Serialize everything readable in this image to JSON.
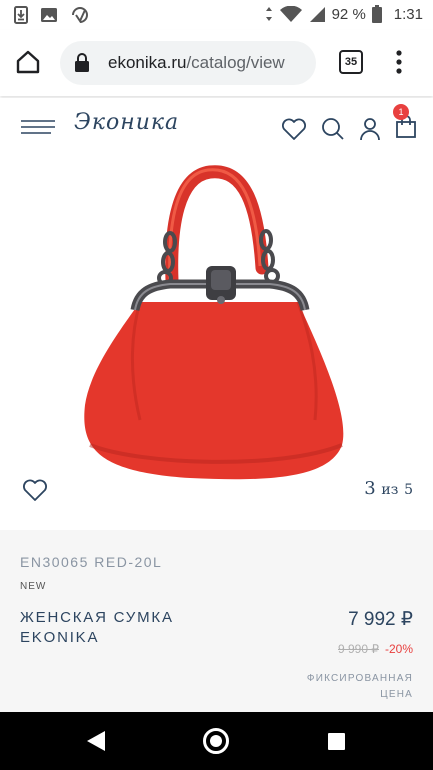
{
  "status_bar": {
    "battery": "92 %",
    "time": "1:31",
    "icons": [
      "download-notification-icon",
      "image-notification-icon",
      "data-saver-icon",
      "wifi-icon",
      "signal-icon",
      "battery-icon"
    ]
  },
  "browser": {
    "url_domain": "ekonika.ru",
    "url_path": "/catalog/view",
    "tab_count": "35",
    "icons": [
      "home-icon",
      "lock-icon",
      "more-vert-icon"
    ]
  },
  "site_header": {
    "logo": "Эконика",
    "cart_count": "1",
    "icons": [
      "hamburger-menu-icon",
      "heart-icon",
      "search-icon",
      "user-icon",
      "shopping-bag-icon"
    ]
  },
  "gallery": {
    "current": "3",
    "separator": "из",
    "total": "5",
    "image_colors": {
      "bag": "#e4372c",
      "frame": "#4a4a4e"
    }
  },
  "product": {
    "sku": "EN30065 RED-20L",
    "tag": "NEW",
    "name": "ЖЕНСКАЯ СУМКА EKONIKA",
    "price": "7 992 ₽",
    "old_price": "9 990 ₽",
    "discount": "-20%",
    "price_note": "ФИКСИРОВАННАЯ ЦЕНА"
  },
  "colors": {
    "brand": "#2d4560",
    "accent": "#e8403f"
  }
}
